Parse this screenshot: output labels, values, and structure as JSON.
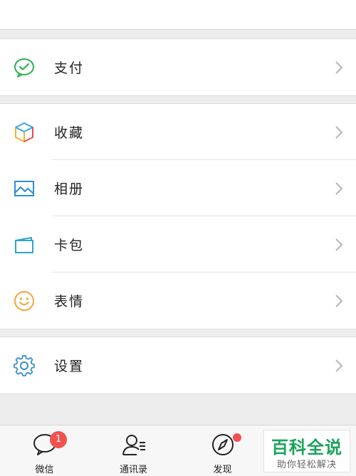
{
  "menu": {
    "pay": {
      "label": "支付",
      "icon": "wechat-pay-icon"
    },
    "favorites": {
      "label": "收藏",
      "icon": "cube-icon"
    },
    "album": {
      "label": "相册",
      "icon": "picture-icon"
    },
    "cards": {
      "label": "卡包",
      "icon": "card-icon"
    },
    "stickers": {
      "label": "表情",
      "icon": "smiley-icon"
    },
    "settings": {
      "label": "设置",
      "icon": "gear-icon"
    }
  },
  "tabbar": {
    "chats": {
      "label": "微信",
      "badge": "1"
    },
    "contacts": {
      "label": "通讯录"
    },
    "discover": {
      "label": "发现"
    }
  },
  "watermark": {
    "main": "百科全说",
    "sub": "助你轻松解决"
  },
  "colors": {
    "accent_green": "#1aa35a",
    "badge_red": "#f0524f",
    "pay_green": "#2bb24c"
  }
}
